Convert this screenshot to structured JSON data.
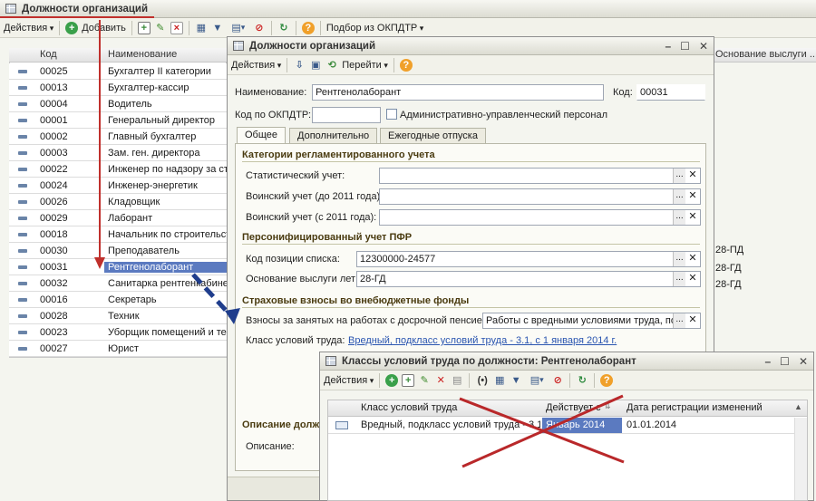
{
  "main_window": {
    "title": "Должности организаций",
    "toolbar": {
      "actions_label": "Действия",
      "add_label": "Добавить",
      "okpdtr_label": "Подбор из ОКПДТР"
    },
    "columns": {
      "code": "Код",
      "name": "Наименование",
      "basis": "Основание выслуги ..."
    },
    "rows": [
      {
        "code": "00025",
        "name": "Бухгалтер II категории"
      },
      {
        "code": "00013",
        "name": "Бухгалтер-кассир"
      },
      {
        "code": "00004",
        "name": "Водитель"
      },
      {
        "code": "00001",
        "name": "Генеральный директор"
      },
      {
        "code": "00002",
        "name": "Главный бухгалтер"
      },
      {
        "code": "00003",
        "name": "Зам. ген. директора"
      },
      {
        "code": "00022",
        "name": "Инженер по надзору за строит"
      },
      {
        "code": "00024",
        "name": "Инженер-энергетик"
      },
      {
        "code": "00026",
        "name": "Кладовщик"
      },
      {
        "code": "00029",
        "name": "Лаборант"
      },
      {
        "code": "00018",
        "name": "Начальник по строительст"
      },
      {
        "code": "00030",
        "name": "Преподаватель"
      },
      {
        "code": "00031",
        "name": "Рентгенолаборант"
      },
      {
        "code": "00032",
        "name": "Санитарка рентгенкабинет"
      },
      {
        "code": "00016",
        "name": "Секретарь"
      },
      {
        "code": "00028",
        "name": "Техник"
      },
      {
        "code": "00023",
        "name": "Уборщик помещений и тер"
      },
      {
        "code": "00027",
        "name": "Юрист"
      }
    ],
    "basis_values": [
      "28-ПД",
      "28-ГД",
      "28-ГД"
    ]
  },
  "form": {
    "title": "Должности организаций",
    "toolbar": {
      "actions_label": "Действия",
      "goto_label": "Перейти"
    },
    "name_label": "Наименование:",
    "name_value": "Рентгенолаборант",
    "code_label": "Код:",
    "code_value": "00031",
    "okpdtr_label": "Код по ОКПДТР:",
    "okpdtr_value": "",
    "admin_staff_label": "Административно-управленческий персонал",
    "tabs": [
      "Общее",
      "Дополнительно",
      "Ежегодные отпуска"
    ],
    "section_categories": "Категории регламентированного учета",
    "stat_label": "Статистический учет:",
    "military_before_label": "Воинский учет (до 2011 года):",
    "military_after_label": "Воинский учет (с 2011 года):",
    "section_pfr": "Персонифицированный учет ПФР",
    "list_position_label": "Код позиции списка:",
    "list_position_value": "12300000-24577",
    "seniority_label": "Основание выслуги лет:",
    "seniority_value": "28-ГД",
    "section_insurance": "Страховые взносы во внебюджетные фонды",
    "early_pension_label": "Взносы за занятых на работах с досрочной пенсией:",
    "early_pension_value": "Работы с вредными условиями труда, подг",
    "work_class_label": "Класс условий труда:",
    "work_class_value": "Вредный, подкласс условий труда - 3.1, с 1 января 2014 г.",
    "section_description": "Описание долж",
    "description_label": "Описание:"
  },
  "classes_window": {
    "title": "Классы условий труда по должности: Рентгенолаборант",
    "toolbar": {
      "actions_label": "Действия"
    },
    "columns": {
      "class": "Класс условий труда",
      "valid_from": "Действует с",
      "registered": "Дата регистрации изменений"
    },
    "rows": [
      {
        "class": "Вредный, подкласс условий труда - 3.1",
        "valid_from": "Январь 2014",
        "registered": "01.01.2014"
      }
    ]
  },
  "colors": {
    "selection": "#5b7ac0",
    "arrow_red": "#c0302c",
    "arrow_blue": "#1f3d8c",
    "cross_red": "#b9282a"
  }
}
